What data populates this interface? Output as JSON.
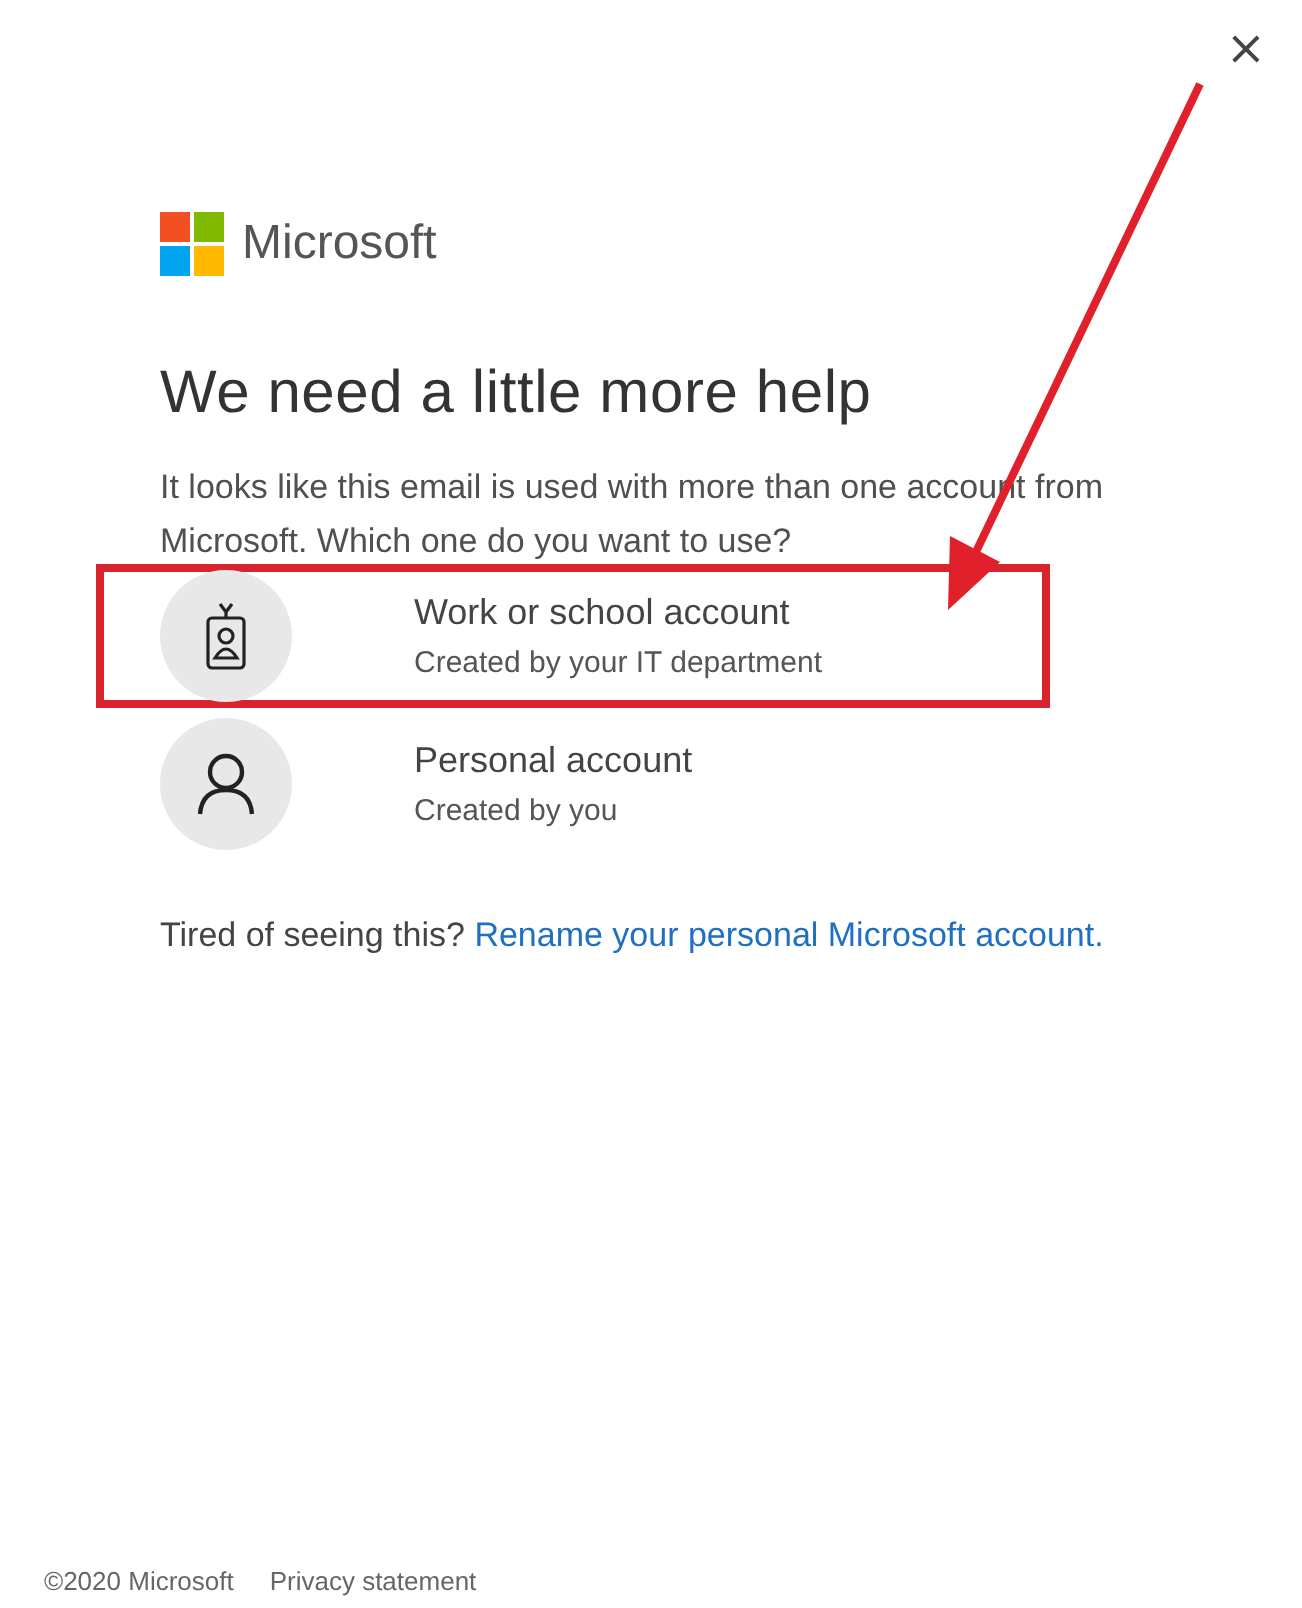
{
  "close_button": "×",
  "brand": "Microsoft",
  "title": "We need a little more help",
  "message": "It looks like this email is used with more than one account from Microsoft. Which one do you want to use?",
  "accounts": [
    {
      "kind": "work",
      "name": "Work or school account",
      "description": "Created by your IT department",
      "marked": true
    },
    {
      "kind": "personal",
      "name": "Personal account",
      "description": "Created by you",
      "marked": false
    }
  ],
  "hint": {
    "text": "Tired of seeing this?",
    "link": "Rename your personal Microsoft account."
  },
  "footer": {
    "copyright": "©2020 Microsoft",
    "privacy": "Privacy statement"
  }
}
